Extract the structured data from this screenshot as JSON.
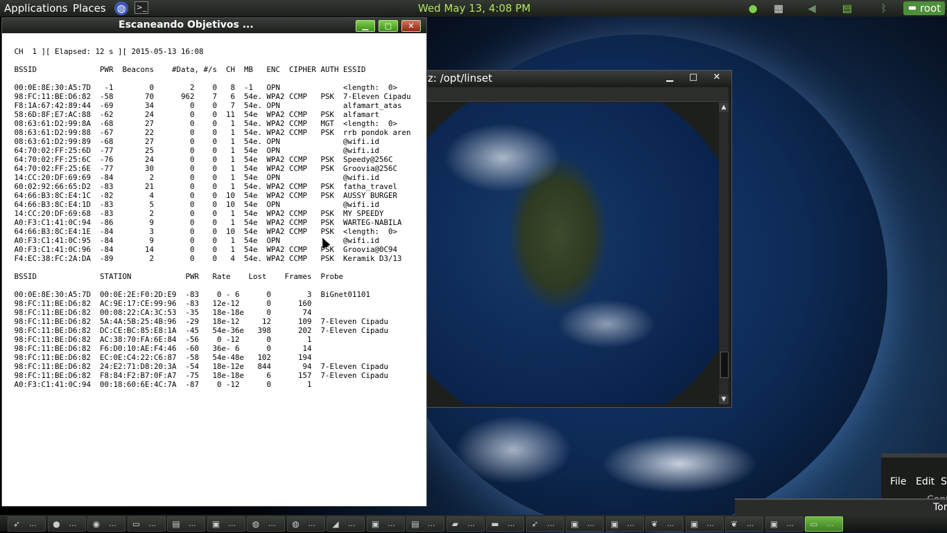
{
  "top_panel": {
    "applications": "Applications",
    "places": "Places",
    "clock": "Wed May 13,  4:08 PM",
    "user": "root"
  },
  "main_window": {
    "title": "Escaneando Objetivos ...",
    "lines": [
      "",
      " CH  1 ][ Elapsed: 12 s ][ 2015-05-13 16:08",
      "",
      " BSSID              PWR  Beacons    #Data, #/s  CH  MB   ENC  CIPHER AUTH ESSID",
      "",
      " 00:0E:8E:30:A5:7D   -1        0        2    0   8  -1   OPN              <length:  0>",
      " 98:FC:11:BE:D6:82  -58       70      962    7   6  54e. WPA2 CCMP   PSK  7-Eleven Cipadu",
      " F8:1A:67:42:89:44  -69       34        0    0   7  54e. OPN              alfamart_atas",
      " 58:6D:8F:E7:AC:88  -62       24        0    0  11  54e  WPA2 CCMP   PSK  alfamart",
      " 08:63:61:D2:99:8A  -68       27        0    0   1  54e. WPA2 CCMP   MGT  <length:  0>",
      " 08:63:61:D2:99:88  -67       22        0    0   1  54e. WPA2 CCMP   PSK  rrb pondok aren",
      " 08:63:61:D2:99:89  -68       27        0    0   1  54e. OPN              @wifi.id",
      " 64:70:02:FF:25:6D  -77       25        0    0   1  54e  OPN              @wifi.id",
      " 64:70:02:FF:25:6C  -76       24        0    0   1  54e  WPA2 CCMP   PSK  Speedy@256C",
      " 64:70:02:FF:25:6E  -77       30        0    0   1  54e  WPA2 CCMP   PSK  Groovia@256C",
      " 14:CC:20:DF:69:69  -84        2        0    0   1  54e  OPN              @wifi.id",
      " 60:02:92:66:65:D2  -83       21        0    0   1  54e. WPA2 CCMP   PSK  fatha_travel",
      " 64:66:B3:8C:E4:1C  -82        4        0    0  10  54e  WPA2 CCMP   PSK  AUSSY BURGER",
      " 64:66:B3:8C:E4:1D  -83        5        0    0  10  54e  OPN              @wifi.id",
      " 14:CC:20:DF:69:68  -83        2        0    0   1  54e  WPA2 CCMP   PSK  MY SPEEDY",
      " A0:F3:C1:41:0C:94  -86        9        0    0   1  54e  WPA2 CCMP   PSK  WARTEG-NABILA",
      " 64:66:B3:8C:E4:1E  -84        3        0    0  10  54e  WPA2 CCMP   PSK  <length:  0>",
      " A0:F3:C1:41:0C:95  -84        9        0    0   1  54e  OPN              @wifi.id",
      " A0:F3:C1:41:0C:96  -84       14        0    0   1  54e  WPA2 CCMP   PSK  Groovia@0C94",
      " F4:EC:38:FC:2A:DA  -89        2        0    0   4  54e. WPA2 CCMP   PSK  Keramik D3/13",
      "",
      " BSSID              STATION            PWR   Rate    Lost    Frames  Probe",
      "",
      " 00:0E:8E:30:A5:7D  00:0E:2E:F0:2D:E9  -83    0 - 6      0        3  BiGnet01101",
      " 98:FC:11:BE:D6:82  AC:9E:17:CE:99:96  -83   12e-12      0      160",
      " 98:FC:11:BE:D6:82  00:08:22:CA:3C:53  -35   18e-18e     0       74",
      " 98:FC:11:BE:D6:82  5A:4A:5B:25:4B:96  -29   18e-12     12      109  7-Eleven Cipadu",
      " 98:FC:11:BE:D6:82  DC:CE:BC:85:E8:1A  -45   54e-36e   398      202  7-Eleven Cipadu",
      " 98:FC:11:BE:D6:82  AC:38:70:FA:6E:84  -56    0 -12      0        1",
      " 98:FC:11:BE:D6:82  F6:D0:10:AE:F4:46  -60   36e- 6      0       14",
      " 98:FC:11:BE:D6:82  EC:0E:C4:22:C6:87  -58   54e-48e   102      194",
      " 98:FC:11:BE:D6:82  24:E2:71:D8:20:3A  -54   18e-12e   844       94  7-Eleven Cipadu",
      " 98:FC:11:BE:D6:82  F8:84:F2:B7:0F:A7  -75   18e-18e     6      157  7-Eleven Cipadu",
      " A0:F3:C1:41:0C:94  00:18:60:6E:4C:7A  -87    0 -12      0        1"
    ]
  },
  "linset_window": {
    "title": "z: /opt/linset"
  },
  "bottom_window": {
    "menu": [
      "File",
      "Edit",
      "S"
    ],
    "partial_text": "Contin"
  },
  "tor_window": {
    "label": "Tor"
  },
  "window_controls": {
    "minimize": "▁",
    "maximize": "□",
    "close": "✕"
  },
  "taskbar": {
    "items": [
      {
        "icon": "kali-icon",
        "glyph": "➶",
        "label": "..."
      },
      {
        "icon": "onion-icon",
        "glyph": "●",
        "label": "..."
      },
      {
        "icon": "globe-icon",
        "glyph": "◉",
        "label": "..."
      },
      {
        "icon": "window-icon",
        "glyph": "▭",
        "label": "..."
      },
      {
        "icon": "terminal-icon",
        "glyph": "▤",
        "label": "..."
      },
      {
        "icon": "terminal-icon",
        "glyph": "▣",
        "label": "..."
      },
      {
        "icon": "browser-icon",
        "glyph": "◍",
        "label": "..."
      },
      {
        "icon": "browser-icon",
        "glyph": "◍",
        "label": "..."
      },
      {
        "icon": "shark-icon",
        "glyph": "◢",
        "label": "..."
      },
      {
        "icon": "terminal-icon",
        "glyph": "▣",
        "label": "..."
      },
      {
        "icon": "text-editor-icon",
        "glyph": "▤",
        "label": "..."
      },
      {
        "icon": "folder-icon",
        "glyph": "▰",
        "label": "..."
      },
      {
        "icon": "window-icon",
        "glyph": "▬",
        "label": "..."
      },
      {
        "icon": "kali-icon",
        "glyph": "➶",
        "label": "..."
      },
      {
        "icon": "terminal-icon",
        "glyph": "▣",
        "label": "..."
      },
      {
        "icon": "terminal-icon",
        "glyph": "▣",
        "label": "..."
      },
      {
        "icon": "leaf-icon",
        "glyph": "❦",
        "label": "..."
      },
      {
        "icon": "terminal-icon",
        "glyph": "▣",
        "label": "..."
      },
      {
        "icon": "leaf-icon",
        "glyph": "❦",
        "label": "..."
      },
      {
        "icon": "terminal-icon",
        "glyph": "▣",
        "label": "..."
      },
      {
        "icon": "window-icon",
        "glyph": "▭",
        "label": "...",
        "active": true
      }
    ]
  },
  "colors": {
    "accent_green": "#4d8f3a",
    "clock_green": "#b4e364"
  }
}
